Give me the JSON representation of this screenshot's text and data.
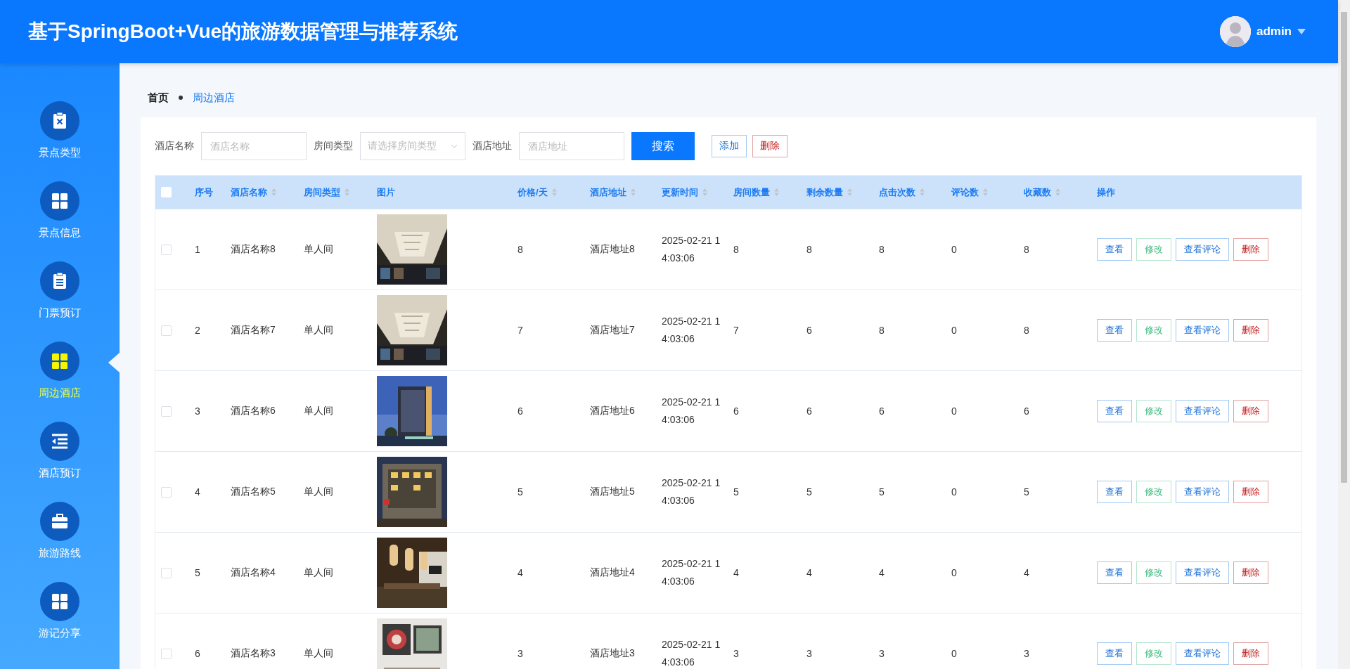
{
  "header": {
    "title": "基于SpringBoot+Vue的旅游数据管理与推荐系统",
    "user": "admin"
  },
  "sidebar": {
    "items": [
      {
        "label": "景点类型",
        "selected": false
      },
      {
        "label": "景点信息",
        "selected": false
      },
      {
        "label": "门票预订",
        "selected": false
      },
      {
        "label": "周边酒店",
        "selected": true
      },
      {
        "label": "酒店预订",
        "selected": false
      },
      {
        "label": "旅游路线",
        "selected": false
      },
      {
        "label": "游记分享",
        "selected": false
      }
    ]
  },
  "breadcrumb": [
    "首页",
    "周边酒店"
  ],
  "filters": [
    {
      "label": "酒店名称",
      "kind": "input",
      "placeholder": "酒店名称"
    },
    {
      "label": "房间类型",
      "kind": "select",
      "placeholder": "请选择房间类型"
    },
    {
      "label": "酒店地址",
      "kind": "input",
      "placeholder": "酒店地址"
    }
  ],
  "toolbar_buttons": [
    {
      "label": "搜索",
      "kind": "primary"
    },
    {
      "label": "添加",
      "kind": "outline"
    },
    {
      "label": "删除",
      "kind": "danger"
    }
  ],
  "table": {
    "select_all_checked": false,
    "columns": [
      {
        "label": "序号",
        "sortable": false
      },
      {
        "label": "酒店名称",
        "sortable": true
      },
      {
        "label": "房间类型",
        "sortable": true
      },
      {
        "label": "图片",
        "sortable": false
      },
      {
        "label": "价格/天",
        "sortable": true
      },
      {
        "label": "酒店地址",
        "sortable": true
      },
      {
        "label": "更新时间",
        "sortable": true
      },
      {
        "label": "房间数量",
        "sortable": true
      },
      {
        "label": "剩余数量",
        "sortable": true
      },
      {
        "label": "点击次数",
        "sortable": true
      },
      {
        "label": "评论数",
        "sortable": true
      },
      {
        "label": "收藏数",
        "sortable": true
      },
      {
        "label": "操作",
        "sortable": false
      }
    ],
    "rows": [
      {
        "checked": false,
        "cells": [
          "1",
          "酒店名称8",
          "单人间",
          {
            "kind": "picture"
          },
          "8",
          "酒店地址8",
          "2025-02-21 14:03:06",
          "8",
          "8",
          "8",
          "0",
          "8"
        ],
        "actions": [
          {
            "label": "查看",
            "kind": "view"
          },
          {
            "label": "修改",
            "kind": "edit"
          },
          {
            "label": "查看评论",
            "kind": "view"
          },
          {
            "label": "删除",
            "kind": "danger"
          }
        ]
      },
      {
        "checked": false,
        "cells": [
          "2",
          "酒店名称7",
          "单人间",
          {
            "kind": "picture"
          },
          "7",
          "酒店地址7",
          "2025-02-21 14:03:06",
          "7",
          "6",
          "8",
          "0",
          "8"
        ],
        "actions": [
          {
            "label": "查看",
            "kind": "view"
          },
          {
            "label": "修改",
            "kind": "edit"
          },
          {
            "label": "查看评论",
            "kind": "view"
          },
          {
            "label": "删除",
            "kind": "danger"
          }
        ]
      },
      {
        "checked": false,
        "cells": [
          "3",
          "酒店名称6",
          "单人间",
          {
            "kind": "picture"
          },
          "6",
          "酒店地址6",
          "2025-02-21 14:03:06",
          "6",
          "6",
          "6",
          "0",
          "6"
        ],
        "actions": [
          {
            "label": "查看",
            "kind": "view"
          },
          {
            "label": "修改",
            "kind": "edit"
          },
          {
            "label": "查看评论",
            "kind": "view"
          },
          {
            "label": "删除",
            "kind": "danger"
          }
        ]
      },
      {
        "checked": false,
        "cells": [
          "4",
          "酒店名称5",
          "单人间",
          {
            "kind": "picture"
          },
          "5",
          "酒店地址5",
          "2025-02-21 14:03:06",
          "5",
          "5",
          "5",
          "0",
          "5"
        ],
        "actions": [
          {
            "label": "查看",
            "kind": "view"
          },
          {
            "label": "修改",
            "kind": "edit"
          },
          {
            "label": "查看评论",
            "kind": "view"
          },
          {
            "label": "删除",
            "kind": "danger"
          }
        ]
      },
      {
        "checked": false,
        "cells": [
          "5",
          "酒店名称4",
          "单人间",
          {
            "kind": "picture"
          },
          "4",
          "酒店地址4",
          "2025-02-21 14:03:06",
          "4",
          "4",
          "4",
          "0",
          "4"
        ],
        "actions": [
          {
            "label": "查看",
            "kind": "view"
          },
          {
            "label": "修改",
            "kind": "edit"
          },
          {
            "label": "查看评论",
            "kind": "view"
          },
          {
            "label": "删除",
            "kind": "danger"
          }
        ]
      },
      {
        "checked": false,
        "cells": [
          "6",
          "酒店名称3",
          "单人间",
          {
            "kind": "picture"
          },
          "3",
          "酒店地址3",
          "2025-02-21 14:03:06",
          "3",
          "3",
          "3",
          "0",
          "3"
        ],
        "actions": [
          {
            "label": "查看",
            "kind": "view"
          },
          {
            "label": "修改",
            "kind": "edit"
          },
          {
            "label": "查看评论",
            "kind": "view"
          },
          {
            "label": "删除",
            "kind": "danger"
          }
        ]
      }
    ]
  }
}
